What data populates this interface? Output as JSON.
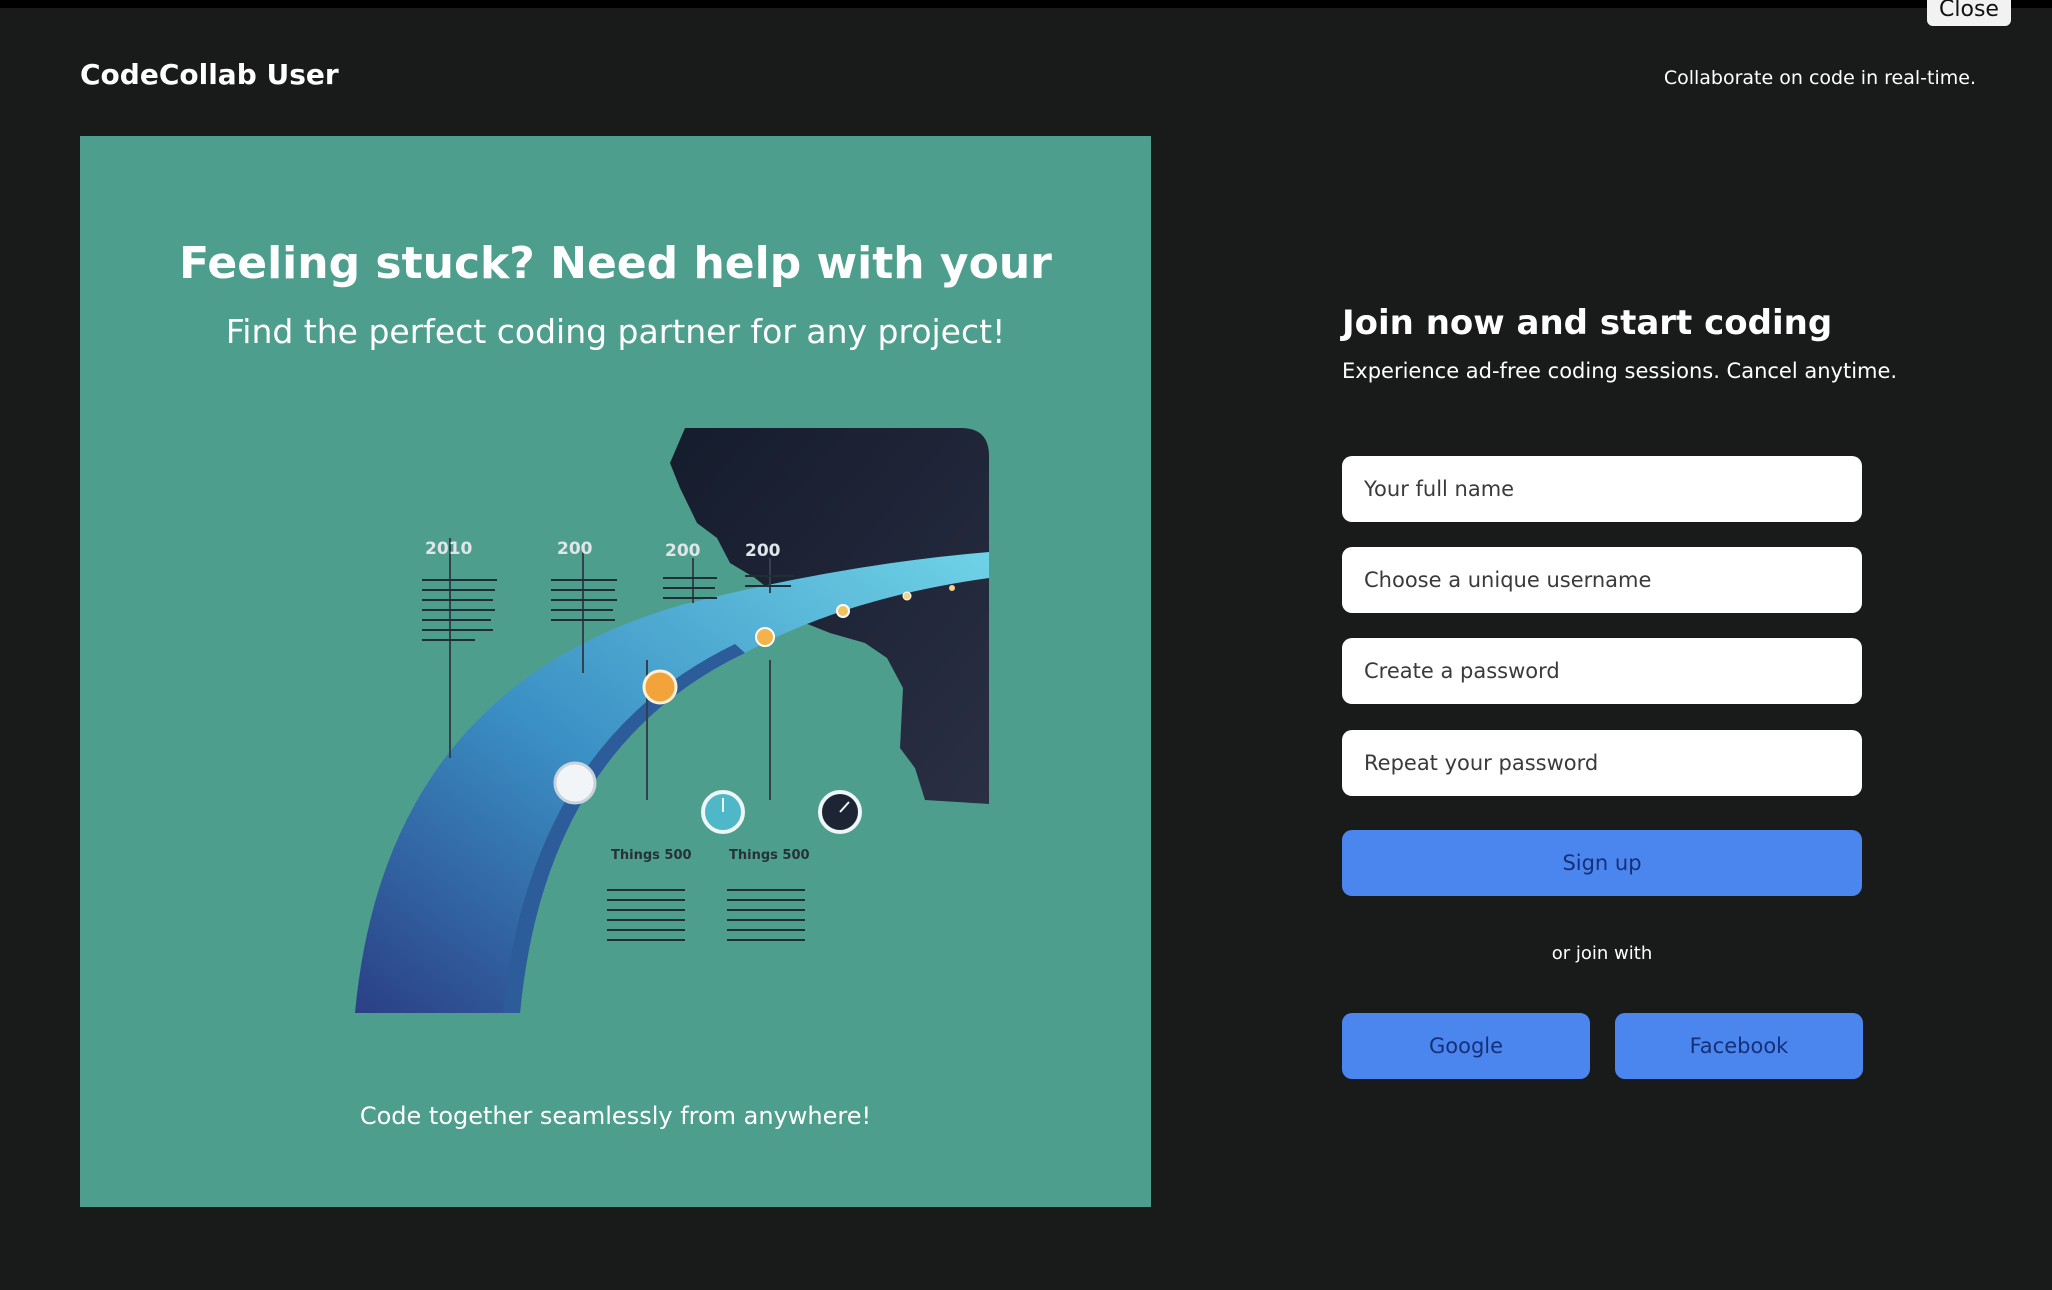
{
  "window": {
    "close_label": "Close"
  },
  "header": {
    "brand": "CodeCollab User",
    "tagline": "Collaborate on code in real-time."
  },
  "promo": {
    "title": "Feeling stuck? Need help with your",
    "subtitle": "Find the perfect coding partner for any project!",
    "footer": "Code together seamlessly from anywhere!",
    "background_color": "#4e9e8e",
    "illustration": {
      "year_labels": [
        "2010",
        "200",
        "200",
        "200"
      ],
      "milestone_labels": [
        "Things 500",
        "Things 500"
      ]
    }
  },
  "signup": {
    "title": "Join now and start coding",
    "description": "Experience ad-free coding sessions. Cancel anytime.",
    "fields": {
      "full_name": {
        "placeholder": "Your full name"
      },
      "username": {
        "placeholder": "Choose a unique username"
      },
      "password": {
        "placeholder": "Create a password"
      },
      "repeat_password": {
        "placeholder": "Repeat your password"
      }
    },
    "submit_label": "Sign up",
    "or_join_text": "or join with",
    "social": {
      "google_label": "Google",
      "facebook_label": "Facebook"
    },
    "button_color": "#4b86ee"
  },
  "theme": {
    "page_background": "#191a1a",
    "text_color": "#ffffff"
  }
}
